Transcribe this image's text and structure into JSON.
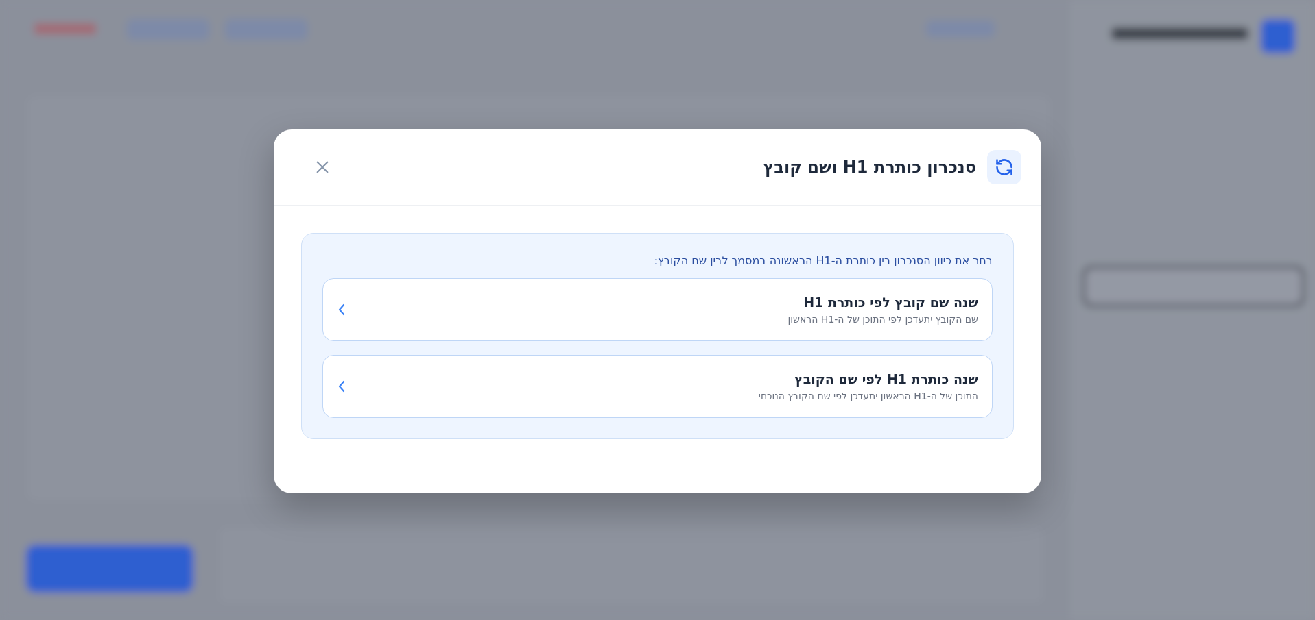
{
  "dialog": {
    "title": "סנכרון כותרת H1 ושם קובץ",
    "prompt": "בחר את כיוון הסנכרון בין כותרת ה-H1 הראשונה במסמך לבין שם הקובץ:",
    "options": [
      {
        "title": "שנה שם קובץ לפי כותרת H1",
        "description": "שם הקובץ יתעדכן לפי התוכן של ה-H1 הראשון"
      },
      {
        "title": "שנה כותרת H1 לפי שם הקובץ",
        "description": "התוכן של ה-H1 הראשון יתעדכן לפי שם הקובץ הנוכחי"
      }
    ]
  }
}
